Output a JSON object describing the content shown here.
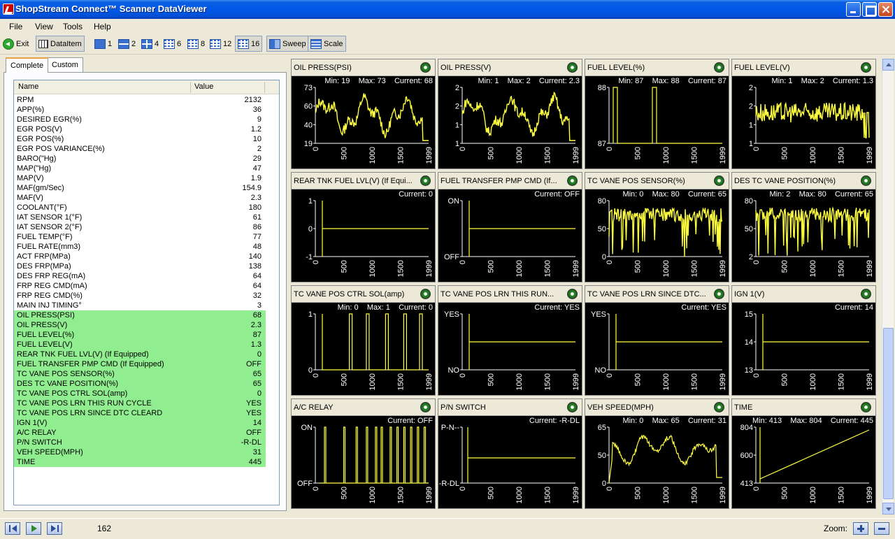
{
  "window": {
    "title": "ShopStream Connect™ Scanner DataViewer"
  },
  "menu": [
    "File",
    "View",
    "Tools",
    "Help"
  ],
  "toolbar": {
    "exit": "Exit",
    "dataitem": "DataItem",
    "layouts": [
      "1",
      "2",
      "4",
      "6",
      "8",
      "12",
      "16"
    ],
    "selected_layout": "16",
    "sweep": "Sweep",
    "scale": "Scale"
  },
  "tabs": {
    "complete": "Complete",
    "custom": "Custom"
  },
  "list": {
    "col_name": "Name",
    "col_value": "Value",
    "rows": [
      {
        "name": "RPM",
        "value": "2132",
        "hl": false
      },
      {
        "name": "APP(%)",
        "value": "36",
        "hl": false
      },
      {
        "name": "DESIRED EGR(%)",
        "value": "9",
        "hl": false
      },
      {
        "name": "EGR POS(V)",
        "value": "1.2",
        "hl": false
      },
      {
        "name": "EGR POS(%)",
        "value": "10",
        "hl": false
      },
      {
        "name": "EGR POS VARIANCE(%)",
        "value": "2",
        "hl": false
      },
      {
        "name": "BARO(\"Hg)",
        "value": "29",
        "hl": false
      },
      {
        "name": "MAP(\"Hg)",
        "value": "47",
        "hl": false
      },
      {
        "name": "MAP(V)",
        "value": "1.9",
        "hl": false
      },
      {
        "name": "MAF(gm/Sec)",
        "value": "154.9",
        "hl": false
      },
      {
        "name": "MAF(V)",
        "value": "2.3",
        "hl": false
      },
      {
        "name": "COOLANT(°F)",
        "value": "180",
        "hl": false
      },
      {
        "name": "IAT SENSOR 1(°F)",
        "value": "61",
        "hl": false
      },
      {
        "name": "IAT SENSOR 2(°F)",
        "value": "86",
        "hl": false
      },
      {
        "name": "FUEL TEMP(°F)",
        "value": "77",
        "hl": false
      },
      {
        "name": "FUEL RATE(mm3)",
        "value": "48",
        "hl": false
      },
      {
        "name": "ACT FRP(MPa)",
        "value": "140",
        "hl": false
      },
      {
        "name": "DES FRP(MPa)",
        "value": "138",
        "hl": false
      },
      {
        "name": "DES FRP REG(mA)",
        "value": "64",
        "hl": false
      },
      {
        "name": "FRP REG CMD(mA)",
        "value": "64",
        "hl": false
      },
      {
        "name": "FRP REG CMD(%)",
        "value": "32",
        "hl": false
      },
      {
        "name": "MAIN INJ TIMING°",
        "value": "3",
        "hl": false
      },
      {
        "name": "OIL PRESS(PSI)",
        "value": "68",
        "hl": true
      },
      {
        "name": "OIL PRESS(V)",
        "value": "2.3",
        "hl": true
      },
      {
        "name": "FUEL LEVEL(%)",
        "value": "87",
        "hl": true
      },
      {
        "name": "FUEL LEVEL(V)",
        "value": "1.3",
        "hl": true
      },
      {
        "name": "REAR TNK FUEL LVL(V) (If Equipped)",
        "value": "0",
        "hl": true
      },
      {
        "name": "FUEL TRANSFER PMP CMD (If Equipped)",
        "value": "OFF",
        "hl": true
      },
      {
        "name": "TC VANE POS SENSOR(%)",
        "value": "65",
        "hl": true
      },
      {
        "name": "DES TC VANE POSITION(%)",
        "value": "65",
        "hl": true
      },
      {
        "name": "TC VANE POS CTRL SOL(amp)",
        "value": "0",
        "hl": true
      },
      {
        "name": "TC VANE POS LRN THIS RUN CYCLE",
        "value": "YES",
        "hl": true
      },
      {
        "name": "TC VANE POS LRN SINCE DTC CLEARD",
        "value": "YES",
        "hl": true
      },
      {
        "name": "IGN 1(V)",
        "value": "14",
        "hl": true
      },
      {
        "name": "A/C RELAY",
        "value": "OFF",
        "hl": true
      },
      {
        "name": "P/N SWITCH",
        "value": "-R-DL",
        "hl": true
      },
      {
        "name": "VEH SPEED(MPH)",
        "value": "31",
        "hl": true
      },
      {
        "name": "TIME",
        "value": "445",
        "hl": true
      }
    ]
  },
  "graph_x_ticks": [
    "0",
    "500",
    "1000",
    "1500",
    "1999"
  ],
  "graphs": [
    {
      "title": "OIL PRESS(PSI)",
      "stats": "Min: 19    Max: 73    Current: 68",
      "ylabels": [
        "73",
        "60",
        "40",
        "19"
      ],
      "kind": "noisy",
      "base": 0.55,
      "amp": 0.35
    },
    {
      "title": "OIL PRESS(V)",
      "stats": "Min: 1    Max: 2    Current: 2.3",
      "ylabels": [
        "2",
        "2",
        "1",
        "1"
      ],
      "kind": "noisy",
      "base": 0.55,
      "amp": 0.35
    },
    {
      "title": "FUEL LEVEL(%)",
      "stats": "Min: 87    Max: 88    Current: 87",
      "ylabels": [
        "88",
        "87"
      ],
      "kind": "fuel"
    },
    {
      "title": "FUEL LEVEL(V)",
      "stats": "Min: 1    Max: 2    Current: 1.3",
      "ylabels": [
        "2",
        "2",
        "1",
        "1"
      ],
      "kind": "band"
    },
    {
      "title": "REAR TNK FUEL LVL(V) (If Equi...",
      "stats": "Current: 0",
      "ylabels": [
        "1",
        "0",
        "-1"
      ],
      "kind": "flat"
    },
    {
      "title": "FUEL TRANSFER PMP CMD (If...",
      "stats": "Current: OFF",
      "ylabels": [
        "ON",
        "OFF"
      ],
      "kind": "flat"
    },
    {
      "title": "TC VANE POS SENSOR(%)",
      "stats": "Min: 0    Max: 80    Current: 65",
      "ylabels": [
        "80",
        "50",
        "0"
      ],
      "kind": "spiky"
    },
    {
      "title": "DES TC VANE POSITION(%)",
      "stats": "Min: 2    Max: 80    Current: 65",
      "ylabels": [
        "80",
        "50",
        "2"
      ],
      "kind": "spiky"
    },
    {
      "title": "TC VANE POS CTRL SOL(amp)",
      "stats": "Min: 0    Max: 1    Current: 0",
      "ylabels": [
        "1",
        "0"
      ],
      "kind": "pulses"
    },
    {
      "title": "TC VANE POS LRN THIS RUN...",
      "stats": "Current: YES",
      "ylabels": [
        "YES",
        "NO"
      ],
      "kind": "flat"
    },
    {
      "title": "TC VANE POS LRN SINCE DTC...",
      "stats": "Current: YES",
      "ylabels": [
        "YES",
        "NO"
      ],
      "kind": "flat"
    },
    {
      "title": "IGN 1(V)",
      "stats": "Current: 14",
      "ylabels": [
        "15",
        "14",
        "13"
      ],
      "kind": "flat"
    },
    {
      "title": "A/C RELAY",
      "stats": "Current: OFF",
      "ylabels": [
        "ON",
        "OFF"
      ],
      "kind": "square"
    },
    {
      "title": "P/N SWITCH",
      "stats": "Current: -R-DL",
      "ylabels": [
        "P-N--",
        "-R-DL"
      ],
      "kind": "flatlow"
    },
    {
      "title": "VEH SPEED(MPH)",
      "stats": "Min: 0    Max: 65    Current: 31",
      "ylabels": [
        "65",
        "50",
        "0"
      ],
      "kind": "speed"
    },
    {
      "title": "TIME",
      "stats": "Min: 413    Max: 804    Current: 445",
      "ylabels": [
        "804",
        "600",
        "413"
      ],
      "kind": "ramp"
    }
  ],
  "status": {
    "frame": "162",
    "zoom": "Zoom:"
  }
}
